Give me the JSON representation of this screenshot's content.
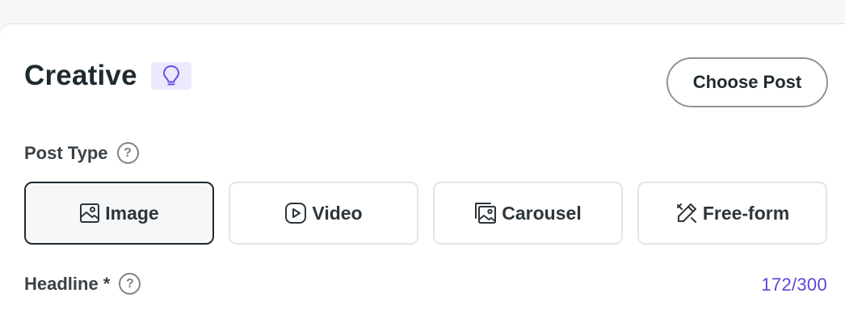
{
  "creative": {
    "title": "Creative",
    "icons": {
      "tip": "lightbulb-icon"
    },
    "choose_post_label": "Choose Post"
  },
  "post_type": {
    "label": "Post Type",
    "help_glyph": "?",
    "selected": "Image",
    "options": [
      {
        "label": "Image",
        "icon": "image-icon"
      },
      {
        "label": "Video",
        "icon": "play-icon"
      },
      {
        "label": "Carousel",
        "icon": "carousel-icon"
      },
      {
        "label": "Free-form",
        "icon": "free-form-icon"
      }
    ]
  },
  "headline": {
    "label": "Headline *",
    "help_glyph": "?",
    "counter": "172/300"
  },
  "colors": {
    "accent": "#5b45d9",
    "badge_bg": "#ede9fc",
    "text": "#1f2a30"
  }
}
